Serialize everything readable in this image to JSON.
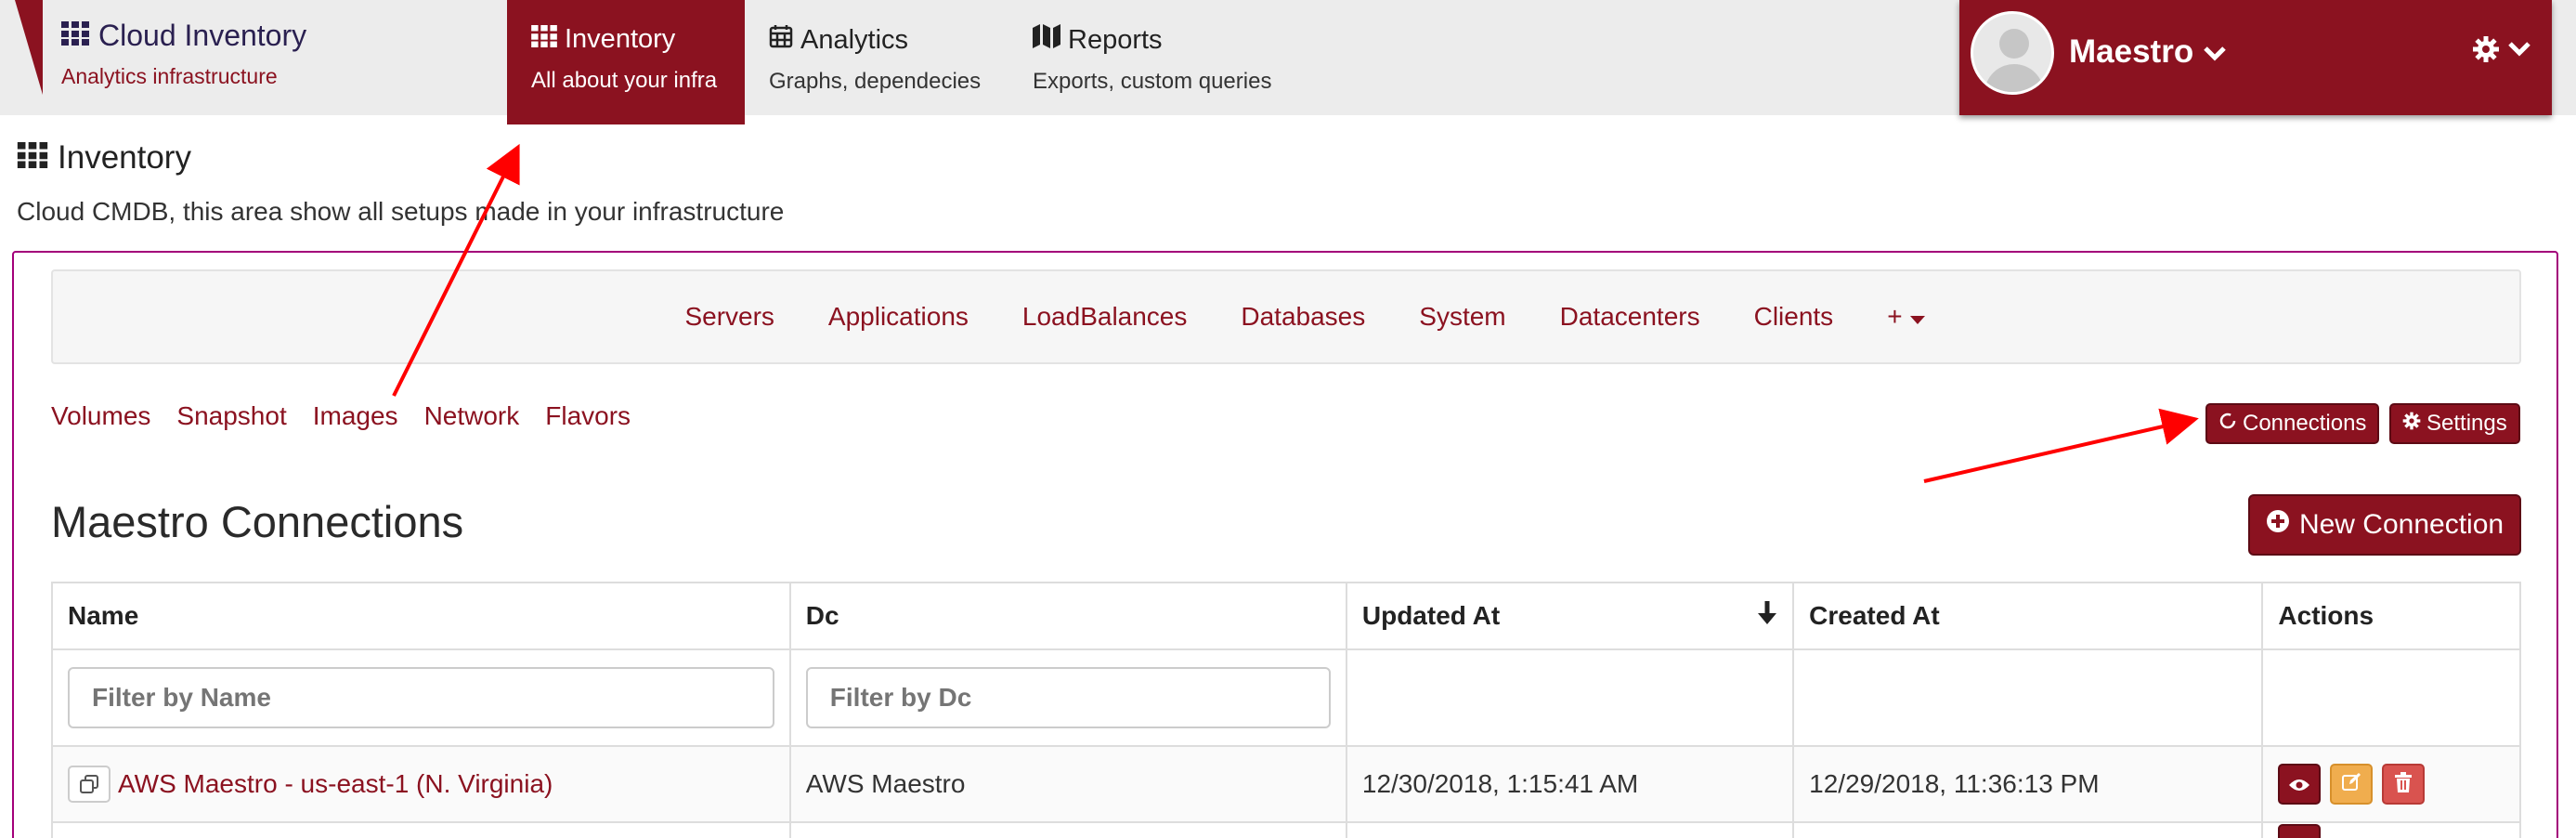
{
  "brand": {
    "title": "Cloud Inventory",
    "subtitle": "Analytics infrastructure"
  },
  "nav": {
    "tabs": [
      {
        "title": "Inventory",
        "subtitle": "All about your infra",
        "icon": "grid-icon",
        "active": true
      },
      {
        "title": "Analytics",
        "subtitle": "Graphs, dependecies",
        "icon": "calendar-icon",
        "active": false
      },
      {
        "title": "Reports",
        "subtitle": "Exports, custom queries",
        "icon": "map-icon",
        "active": false
      }
    ]
  },
  "user": {
    "name": "Maestro"
  },
  "page": {
    "title": "Inventory",
    "description": "Cloud CMDB, this area show all setups made in your infrastructure"
  },
  "subnav": {
    "items": [
      "Servers",
      "Applications",
      "LoadBalances",
      "Databases",
      "System",
      "Datacenters",
      "Clients"
    ],
    "more_label": "+"
  },
  "secondary_links": [
    "Volumes",
    "Snapshot",
    "Images",
    "Network",
    "Flavors"
  ],
  "toolbar": {
    "connections_label": "Connections",
    "settings_label": "Settings"
  },
  "section": {
    "title": "Maestro Connections",
    "new_button_label": "New Connection"
  },
  "table": {
    "columns": [
      "Name",
      "Dc",
      "Updated At",
      "Created At",
      "Actions"
    ],
    "filters": {
      "name_placeholder": "Filter by Name",
      "dc_placeholder": "Filter by Dc"
    },
    "rows": [
      {
        "name": "AWS Maestro - us-east-1 (N. Virginia)",
        "dc": "AWS Maestro",
        "updated_at": "12/30/2018, 1:15:41 AM",
        "created_at": "12/29/2018, 11:36:13 PM"
      }
    ]
  },
  "colors": {
    "accent": "#8b1220",
    "panel_border": "#a3007a",
    "warning": "#f0ad4e",
    "danger": "#d9534f",
    "annotation": "#ff0000"
  }
}
